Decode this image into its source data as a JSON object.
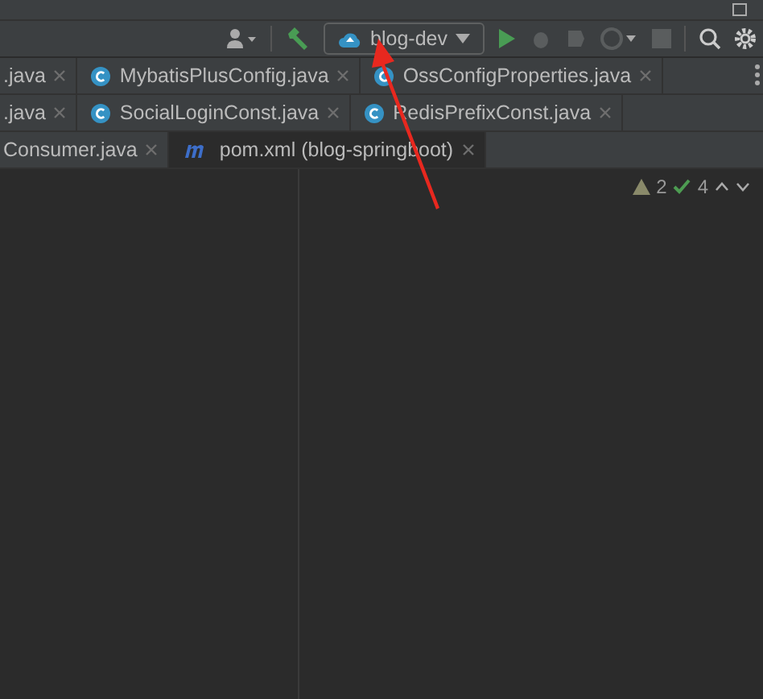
{
  "toolbar": {
    "run_config": "blog-dev"
  },
  "tab_rows": [
    [
      {
        "label": ".java",
        "kind": "plain",
        "selected": false
      },
      {
        "label": "MybatisPlusConfig.java",
        "kind": "class",
        "selected": false
      },
      {
        "label": "OssConfigProperties.java",
        "kind": "class",
        "selected": false
      }
    ],
    [
      {
        "label": ".java",
        "kind": "plain",
        "selected": false
      },
      {
        "label": "SocialLoginConst.java",
        "kind": "class",
        "selected": false
      },
      {
        "label": "RedisPrefixConst.java",
        "kind": "class",
        "selected": false
      }
    ],
    [
      {
        "label": "Consumer.java",
        "kind": "plain",
        "selected": false
      },
      {
        "label": "pom.xml (blog-springboot)",
        "kind": "maven",
        "selected": true
      }
    ]
  ],
  "inspections": {
    "warnings": "2",
    "typos": "4"
  }
}
